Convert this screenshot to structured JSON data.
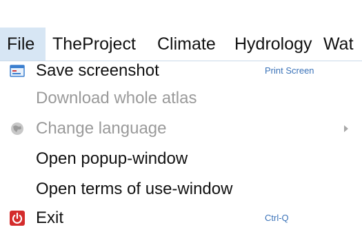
{
  "menubar": {
    "items": [
      {
        "label": "File"
      },
      {
        "label": "TheProject"
      },
      {
        "label": "Climate"
      },
      {
        "label": "Hydrology"
      },
      {
        "label": "Wat"
      }
    ],
    "active_color": "#d7e6f4"
  },
  "file_menu": {
    "items": [
      {
        "label": "Save screenshot",
        "shortcut": "Print Screen",
        "icon": "screenshot-icon",
        "enabled": true
      },
      {
        "label": "Download whole atlas",
        "enabled": false
      },
      {
        "label": "Change language",
        "icon": "globe-icon",
        "enabled": false,
        "has_submenu": true
      },
      {
        "label": "Open popup-window",
        "enabled": true
      },
      {
        "label": "Open terms of use-window",
        "enabled": true
      },
      {
        "label": "Exit",
        "shortcut": "Ctrl-Q",
        "icon": "power-icon",
        "enabled": true
      }
    ],
    "shortcut_color": "#3a72b8",
    "disabled_color": "#9a9a9a"
  }
}
